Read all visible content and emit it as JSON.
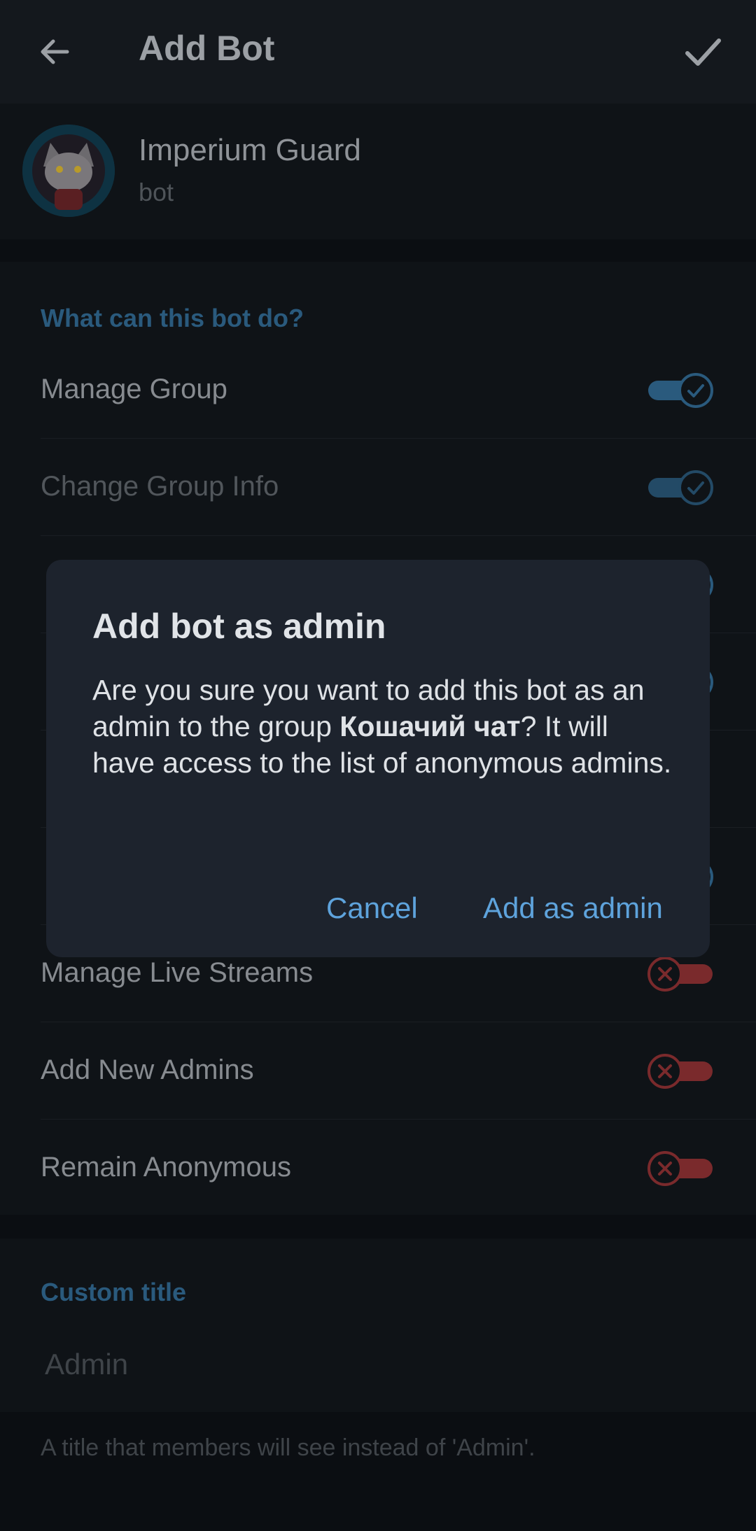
{
  "appbar": {
    "title": "Add Bot"
  },
  "bot": {
    "name": "Imperium Guard",
    "subtitle": "bot"
  },
  "permissions": {
    "header": "What can this bot do?",
    "items": [
      {
        "label": "Manage Group",
        "enabled": true
      },
      {
        "label": "Change Group Info",
        "enabled": true
      },
      {
        "label": "Manage Live Streams",
        "enabled": false
      },
      {
        "label": "Add New Admins",
        "enabled": false
      },
      {
        "label": "Remain Anonymous",
        "enabled": false
      }
    ]
  },
  "custom_title": {
    "header": "Custom title",
    "placeholder": "Admin",
    "hint": "A title that members will see instead of 'Admin'."
  },
  "dialog": {
    "title": "Add bot as admin",
    "message_before": "Are you sure you want to add this bot as an admin to the group ",
    "group_name": "Кошачий чат",
    "message_after": "? It will have access to the list of anonymous admins.",
    "cancel": "Cancel",
    "confirm": "Add as admin"
  },
  "colors": {
    "accent": "#5ea3dc",
    "toggle_on": "#2a5a7d",
    "toggle_off": "#7a2a2c",
    "dialog_bg": "#1d232d"
  }
}
